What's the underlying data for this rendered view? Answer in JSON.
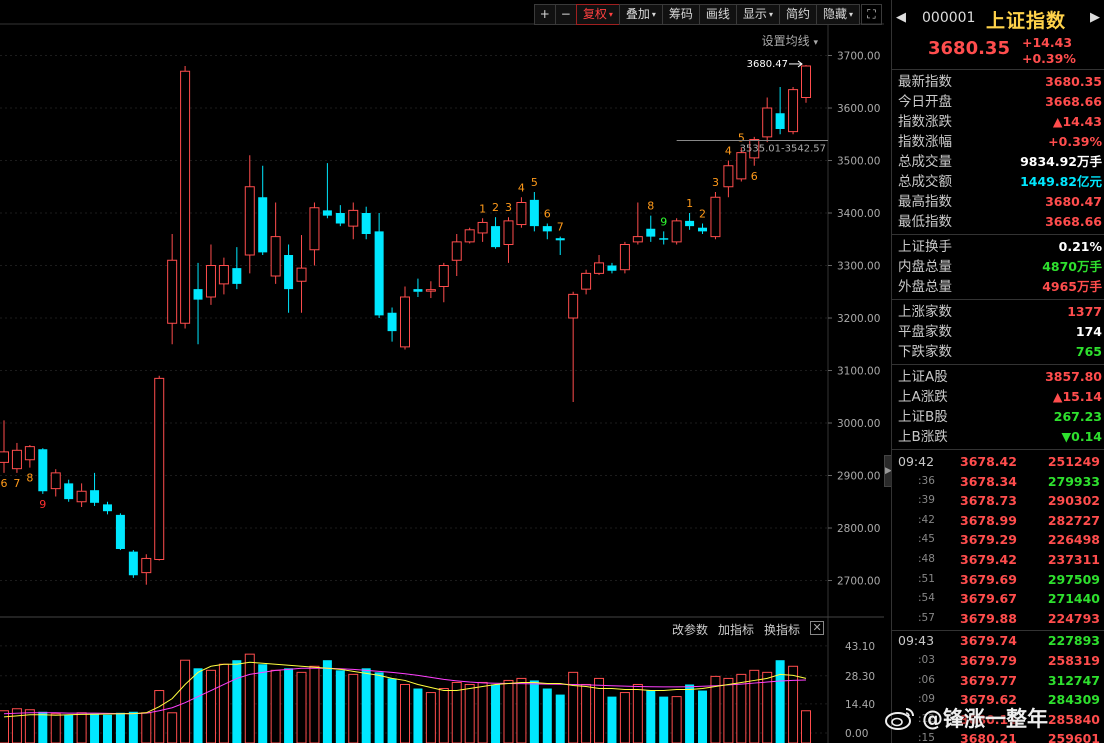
{
  "toolbar": {
    "plus": "+",
    "minus": "−",
    "buttons": [
      {
        "label": "复权",
        "dropdown": true,
        "active": true
      },
      {
        "label": "叠加",
        "dropdown": true,
        "active": false
      },
      {
        "label": "筹码",
        "dropdown": false,
        "active": false
      },
      {
        "label": "画线",
        "dropdown": false,
        "active": false
      },
      {
        "label": "显示",
        "dropdown": true,
        "active": false
      },
      {
        "label": "简约",
        "dropdown": false,
        "active": false
      },
      {
        "label": "隐藏",
        "dropdown": true,
        "active": false
      }
    ],
    "ma_setting": "设置均线",
    "dropdown_glyph": "▾"
  },
  "volume_panel": {
    "change_param": "改参数",
    "add_indicator": "加指标",
    "change_indicator": "换指标",
    "close_glyph": "✕"
  },
  "chart_data": {
    "type": "candlestick",
    "price_axis": {
      "ticks": [
        2700,
        2800,
        2900,
        3000,
        3100,
        3200,
        3300,
        3400,
        3500,
        3600,
        3700
      ],
      "tick_labels": [
        "2700.00",
        "2800.00",
        "2900.00",
        "3000.00",
        "3100.00",
        "3200.00",
        "3300.00",
        "3400.00",
        "3500.00",
        "3600.00",
        "3700.00"
      ],
      "range": [
        2640,
        3760
      ]
    },
    "volume_axis": {
      "ticks": [
        0,
        14.4,
        28.3,
        43.1
      ],
      "tick_labels": [
        "0.00",
        "14.40",
        "28.30",
        "43.10"
      ],
      "range": [
        0,
        46
      ]
    },
    "high_label": "3680.47",
    "ref_label": "3535.01-3542.57",
    "candles": [
      {
        "o": 2925,
        "c": 2945,
        "h": 3005,
        "l": 2905,
        "v": 11
      },
      {
        "o": 2913,
        "c": 2948,
        "h": 2962,
        "l": 2905,
        "v": 12
      },
      {
        "o": 2930,
        "c": 2955,
        "h": 2958,
        "l": 2915,
        "v": 11.5
      },
      {
        "o": 2950,
        "c": 2870,
        "h": 2952,
        "l": 2865,
        "v": 10.5
      },
      {
        "o": 2875,
        "c": 2905,
        "h": 2912,
        "l": 2860,
        "v": 9.5
      },
      {
        "o": 2885,
        "c": 2855,
        "h": 2892,
        "l": 2850,
        "v": 9
      },
      {
        "o": 2850,
        "c": 2870,
        "h": 2885,
        "l": 2840,
        "v": 10
      },
      {
        "o": 2872,
        "c": 2848,
        "h": 2905,
        "l": 2842,
        "v": 9.5
      },
      {
        "o": 2845,
        "c": 2832,
        "h": 2850,
        "l": 2826,
        "v": 9
      },
      {
        "o": 2825,
        "c": 2760,
        "h": 2828,
        "l": 2758,
        "v": 10
      },
      {
        "o": 2755,
        "c": 2710,
        "h": 2758,
        "l": 2705,
        "v": 10.5
      },
      {
        "o": 2715,
        "c": 2742,
        "h": 2750,
        "l": 2692,
        "v": 10
      },
      {
        "o": 2740,
        "c": 3085,
        "h": 3090,
        "l": 2738,
        "v": 21
      },
      {
        "o": 3190,
        "c": 3310,
        "h": 3360,
        "l": 3150,
        "v": 10
      },
      {
        "o": 3190,
        "c": 3670,
        "h": 3680,
        "l": 3180,
        "v": 36
      },
      {
        "o": 3255,
        "c": 3235,
        "h": 3305,
        "l": 3150,
        "v": 32
      },
      {
        "o": 3240,
        "c": 3300,
        "h": 3340,
        "l": 3225,
        "v": 31
      },
      {
        "o": 3265,
        "c": 3300,
        "h": 3315,
        "l": 3245,
        "v": 34
      },
      {
        "o": 3295,
        "c": 3265,
        "h": 3335,
        "l": 3255,
        "v": 36
      },
      {
        "o": 3320,
        "c": 3450,
        "h": 3510,
        "l": 3285,
        "v": 39
      },
      {
        "o": 3430,
        "c": 3325,
        "h": 3490,
        "l": 3320,
        "v": 34
      },
      {
        "o": 3280,
        "c": 3355,
        "h": 3420,
        "l": 3265,
        "v": 31
      },
      {
        "o": 3320,
        "c": 3255,
        "h": 3340,
        "l": 3210,
        "v": 32
      },
      {
        "o": 3270,
        "c": 3295,
        "h": 3358,
        "l": 3210,
        "v": 30
      },
      {
        "o": 3330,
        "c": 3410,
        "h": 3420,
        "l": 3300,
        "v": 33
      },
      {
        "o": 3405,
        "c": 3395,
        "h": 3495,
        "l": 3390,
        "v": 36
      },
      {
        "o": 3400,
        "c": 3380,
        "h": 3415,
        "l": 3375,
        "v": 31
      },
      {
        "o": 3375,
        "c": 3405,
        "h": 3420,
        "l": 3350,
        "v": 29
      },
      {
        "o": 3400,
        "c": 3360,
        "h": 3412,
        "l": 3350,
        "v": 32
      },
      {
        "o": 3365,
        "c": 3205,
        "h": 3400,
        "l": 3200,
        "v": 30
      },
      {
        "o": 3210,
        "c": 3175,
        "h": 3220,
        "l": 3155,
        "v": 27
      },
      {
        "o": 3145,
        "c": 3240,
        "h": 3260,
        "l": 3140,
        "v": 24
      },
      {
        "o": 3255,
        "c": 3250,
        "h": 3275,
        "l": 3240,
        "v": 22
      },
      {
        "o": 3252,
        "c": 3254,
        "h": 3270,
        "l": 3238,
        "v": 20
      },
      {
        "o": 3260,
        "c": 3300,
        "h": 3305,
        "l": 3230,
        "v": 22
      },
      {
        "o": 3310,
        "c": 3345,
        "h": 3360,
        "l": 3280,
        "v": 25
      },
      {
        "o": 3345,
        "c": 3368,
        "h": 3372,
        "l": 3342,
        "v": 24
      },
      {
        "o": 3362,
        "c": 3382,
        "h": 3390,
        "l": 3345,
        "v": 25
      },
      {
        "o": 3375,
        "c": 3335,
        "h": 3392,
        "l": 3332,
        "v": 24
      },
      {
        "o": 3340,
        "c": 3385,
        "h": 3392,
        "l": 3305,
        "v": 26
      },
      {
        "o": 3378,
        "c": 3420,
        "h": 3430,
        "l": 3372,
        "v": 27
      },
      {
        "o": 3425,
        "c": 3375,
        "h": 3440,
        "l": 3365,
        "v": 26
      },
      {
        "o": 3375,
        "c": 3365,
        "h": 3380,
        "l": 3350,
        "v": 22
      },
      {
        "o": 3352,
        "c": 3348,
        "h": 3355,
        "l": 3320,
        "v": 19
      },
      {
        "o": 3200,
        "c": 3245,
        "h": 3250,
        "l": 3040,
        "v": 30
      },
      {
        "o": 3255,
        "c": 3285,
        "h": 3292,
        "l": 3245,
        "v": 24
      },
      {
        "o": 3285,
        "c": 3305,
        "h": 3320,
        "l": 3282,
        "v": 27
      },
      {
        "o": 3300,
        "c": 3290,
        "h": 3305,
        "l": 3285,
        "v": 18
      },
      {
        "o": 3292,
        "c": 3340,
        "h": 3345,
        "l": 3285,
        "v": 20
      },
      {
        "o": 3345,
        "c": 3355,
        "h": 3420,
        "l": 3340,
        "v": 24
      },
      {
        "o": 3370,
        "c": 3355,
        "h": 3395,
        "l": 3345,
        "v": 21
      },
      {
        "o": 3352,
        "c": 3350,
        "h": 3365,
        "l": 3340,
        "v": 18
      },
      {
        "o": 3345,
        "c": 3385,
        "h": 3390,
        "l": 3340,
        "v": 18
      },
      {
        "o": 3385,
        "c": 3375,
        "h": 3400,
        "l": 3368,
        "v": 24
      },
      {
        "o": 3372,
        "c": 3365,
        "h": 3380,
        "l": 3360,
        "v": 21
      },
      {
        "o": 3355,
        "c": 3430,
        "h": 3440,
        "l": 3350,
        "v": 28
      },
      {
        "o": 3450,
        "c": 3490,
        "h": 3500,
        "l": 3430,
        "v": 27
      },
      {
        "o": 3465,
        "c": 3515,
        "h": 3525,
        "l": 3460,
        "v": 29
      },
      {
        "o": 3505,
        "c": 3540,
        "h": 3545,
        "l": 3490,
        "v": 31
      },
      {
        "o": 3545,
        "c": 3600,
        "h": 3620,
        "l": 3535,
        "v": 30
      },
      {
        "o": 3590,
        "c": 3560,
        "h": 3640,
        "l": 3550,
        "v": 36
      },
      {
        "o": 3555,
        "c": 3635,
        "h": 3640,
        "l": 3550,
        "v": 33
      },
      {
        "o": 3620,
        "c": 3680,
        "h": 3682,
        "l": 3610,
        "v": 11
      }
    ],
    "ma_short": [
      8,
      8.5,
      9,
      9,
      8.8,
      9,
      9.2,
      9.3,
      9.4,
      9.5,
      9.6,
      10,
      13,
      17,
      24,
      30,
      33,
      34,
      34,
      35,
      34.5,
      34,
      33.5,
      33,
      32.5,
      32,
      31.5,
      30.5,
      29.5,
      28.5,
      27,
      26,
      24,
      22.5,
      21,
      21,
      22,
      23,
      24,
      24.5,
      25,
      25,
      24.5,
      24.5,
      23.5,
      23,
      22,
      22,
      21.5,
      21.5,
      21,
      21,
      21.5,
      21.5,
      22,
      23,
      24,
      25,
      26,
      27,
      29,
      28.5,
      27
    ],
    "ma_long": [
      9.5,
      9.8,
      10,
      10,
      10,
      9.8,
      9.8,
      9.8,
      9.7,
      9.6,
      9.6,
      9.8,
      11,
      12.5,
      15,
      18,
      21,
      24,
      27,
      29,
      30,
      31,
      31.5,
      32,
      32,
      32,
      31.8,
      31.5,
      31,
      30.5,
      30,
      29.3,
      28.5,
      27.5,
      26.5,
      25.8,
      25.2,
      24.8,
      24.6,
      24.5,
      24.4,
      24.3,
      24.2,
      24.1,
      24,
      23.8,
      23.6,
      23.4,
      23.2,
      23,
      22.9,
      22.8,
      22.8,
      22.9,
      23.1,
      23.4,
      23.8,
      24.2,
      24.7,
      25.2,
      25.7,
      26,
      26.2
    ],
    "td_labels": [
      {
        "i": 0,
        "t": "6",
        "c": "orange",
        "pos": "below"
      },
      {
        "i": 1,
        "t": "7",
        "c": "orange",
        "pos": "below"
      },
      {
        "i": 2,
        "t": "8",
        "c": "orange",
        "pos": "below"
      },
      {
        "i": 3,
        "t": "9",
        "c": "red",
        "pos": "below"
      },
      {
        "i": 37,
        "t": "1",
        "c": "orange",
        "pos": "above"
      },
      {
        "i": 38,
        "t": "2",
        "c": "orange",
        "pos": "above"
      },
      {
        "i": 39,
        "t": "3",
        "c": "orange",
        "pos": "above"
      },
      {
        "i": 40,
        "t": "4",
        "c": "orange",
        "pos": "above"
      },
      {
        "i": 41,
        "t": "5",
        "c": "orange",
        "pos": "above"
      },
      {
        "i": 42,
        "t": "6",
        "c": "orange",
        "pos": "above"
      },
      {
        "i": 43,
        "t": "7",
        "c": "orange",
        "pos": "above"
      },
      {
        "i": 50,
        "t": "8",
        "c": "orange",
        "pos": "above"
      },
      {
        "i": 51,
        "t": "9",
        "c": "green",
        "pos": "above"
      },
      {
        "i": 53,
        "t": "1",
        "c": "orange",
        "pos": "above"
      },
      {
        "i": 54,
        "t": "2",
        "c": "orange",
        "pos": "above"
      },
      {
        "i": 55,
        "t": "3",
        "c": "orange",
        "pos": "above"
      },
      {
        "i": 56,
        "t": "4",
        "c": "orange",
        "pos": "above"
      },
      {
        "i": 57,
        "t": "5",
        "c": "orange",
        "pos": "above"
      },
      {
        "i": 58,
        "t": "6",
        "c": "orange",
        "pos": "below"
      }
    ],
    "colors": {
      "up": "#ff4d4d",
      "down": "#00e8ff",
      "ma_short": "#ffff40",
      "ma_long": "#ff40ff",
      "grid": "#222",
      "axis_text": "#aaaaaa"
    }
  },
  "side": {
    "nav_prev": "◀",
    "nav_next": "▶",
    "code": "000001",
    "name": "上证指数",
    "price": "3680.35",
    "change": "+14.43",
    "change_pct": "+0.39%",
    "rows1": [
      {
        "k": "最新指数",
        "v": "3680.35",
        "c": "red"
      },
      {
        "k": "今日开盘",
        "v": "3668.66",
        "c": "red"
      },
      {
        "k": "指数涨跌",
        "v": "▲14.43",
        "c": "red"
      },
      {
        "k": "指数涨幅",
        "v": "+0.39%",
        "c": "red"
      },
      {
        "k": "总成交量",
        "v": "9834.92万手",
        "c": "white"
      },
      {
        "k": "总成交额",
        "v": "1449.82亿元",
        "c": "cyan"
      },
      {
        "k": "最高指数",
        "v": "3680.47",
        "c": "red"
      },
      {
        "k": "最低指数",
        "v": "3668.66",
        "c": "red"
      }
    ],
    "rows2": [
      {
        "k": "上证换手",
        "v": "0.21%",
        "c": "white"
      },
      {
        "k": "内盘总量",
        "v": "4870万手",
        "c": "green"
      },
      {
        "k": "外盘总量",
        "v": "4965万手",
        "c": "red"
      }
    ],
    "rows3": [
      {
        "k": "上涨家数",
        "v": "1377",
        "c": "red"
      },
      {
        "k": "平盘家数",
        "v": "174",
        "c": "white"
      },
      {
        "k": "下跌家数",
        "v": "765",
        "c": "green"
      }
    ],
    "rows4": [
      {
        "k": "上证A股",
        "v": "3857.80",
        "c": "red"
      },
      {
        "k": "上A涨跌",
        "v": "▲15.14",
        "c": "red"
      },
      {
        "k": "上证B股",
        "v": "267.23",
        "c": "green"
      },
      {
        "k": "上B涨跌",
        "v": "▼0.14",
        "c": "green"
      }
    ],
    "ticks_a": [
      {
        "t": "09:42",
        "p": "3678.42",
        "q": "251249",
        "qc": "red",
        "small": false
      },
      {
        "t": ":36",
        "p": "3678.34",
        "q": "279933",
        "qc": "green",
        "small": true
      },
      {
        "t": ":39",
        "p": "3678.73",
        "q": "290302",
        "qc": "red",
        "small": true
      },
      {
        "t": ":42",
        "p": "3678.99",
        "q": "282727",
        "qc": "red",
        "small": true
      },
      {
        "t": ":45",
        "p": "3679.29",
        "q": "226498",
        "qc": "red",
        "small": true
      },
      {
        "t": ":48",
        "p": "3679.42",
        "q": "237311",
        "qc": "red",
        "small": true
      },
      {
        "t": ":51",
        "p": "3679.69",
        "q": "297509",
        "qc": "green",
        "small": true
      },
      {
        "t": ":54",
        "p": "3679.67",
        "q": "271440",
        "qc": "green",
        "small": true
      },
      {
        "t": ":57",
        "p": "3679.88",
        "q": "224793",
        "qc": "red",
        "small": true
      }
    ],
    "ticks_b": [
      {
        "t": "09:43",
        "p": "3679.74",
        "q": "227893",
        "qc": "green",
        "small": false
      },
      {
        "t": ":03",
        "p": "3679.79",
        "q": "258319",
        "qc": "red",
        "small": true
      },
      {
        "t": ":06",
        "p": "3679.77",
        "q": "312747",
        "qc": "green",
        "small": true
      },
      {
        "t": ":09",
        "p": "3679.62",
        "q": "284309",
        "qc": "green",
        "small": true
      },
      {
        "t": ":12",
        "p": "3680.11",
        "q": "285840",
        "qc": "red",
        "small": true
      },
      {
        "t": ":15",
        "p": "3680.21",
        "q": "259601",
        "qc": "red",
        "small": true
      }
    ]
  },
  "watermark": {
    "text": "@锋涨一整年",
    "icon": "weibo-icon"
  },
  "collapse_glyph": "▶"
}
